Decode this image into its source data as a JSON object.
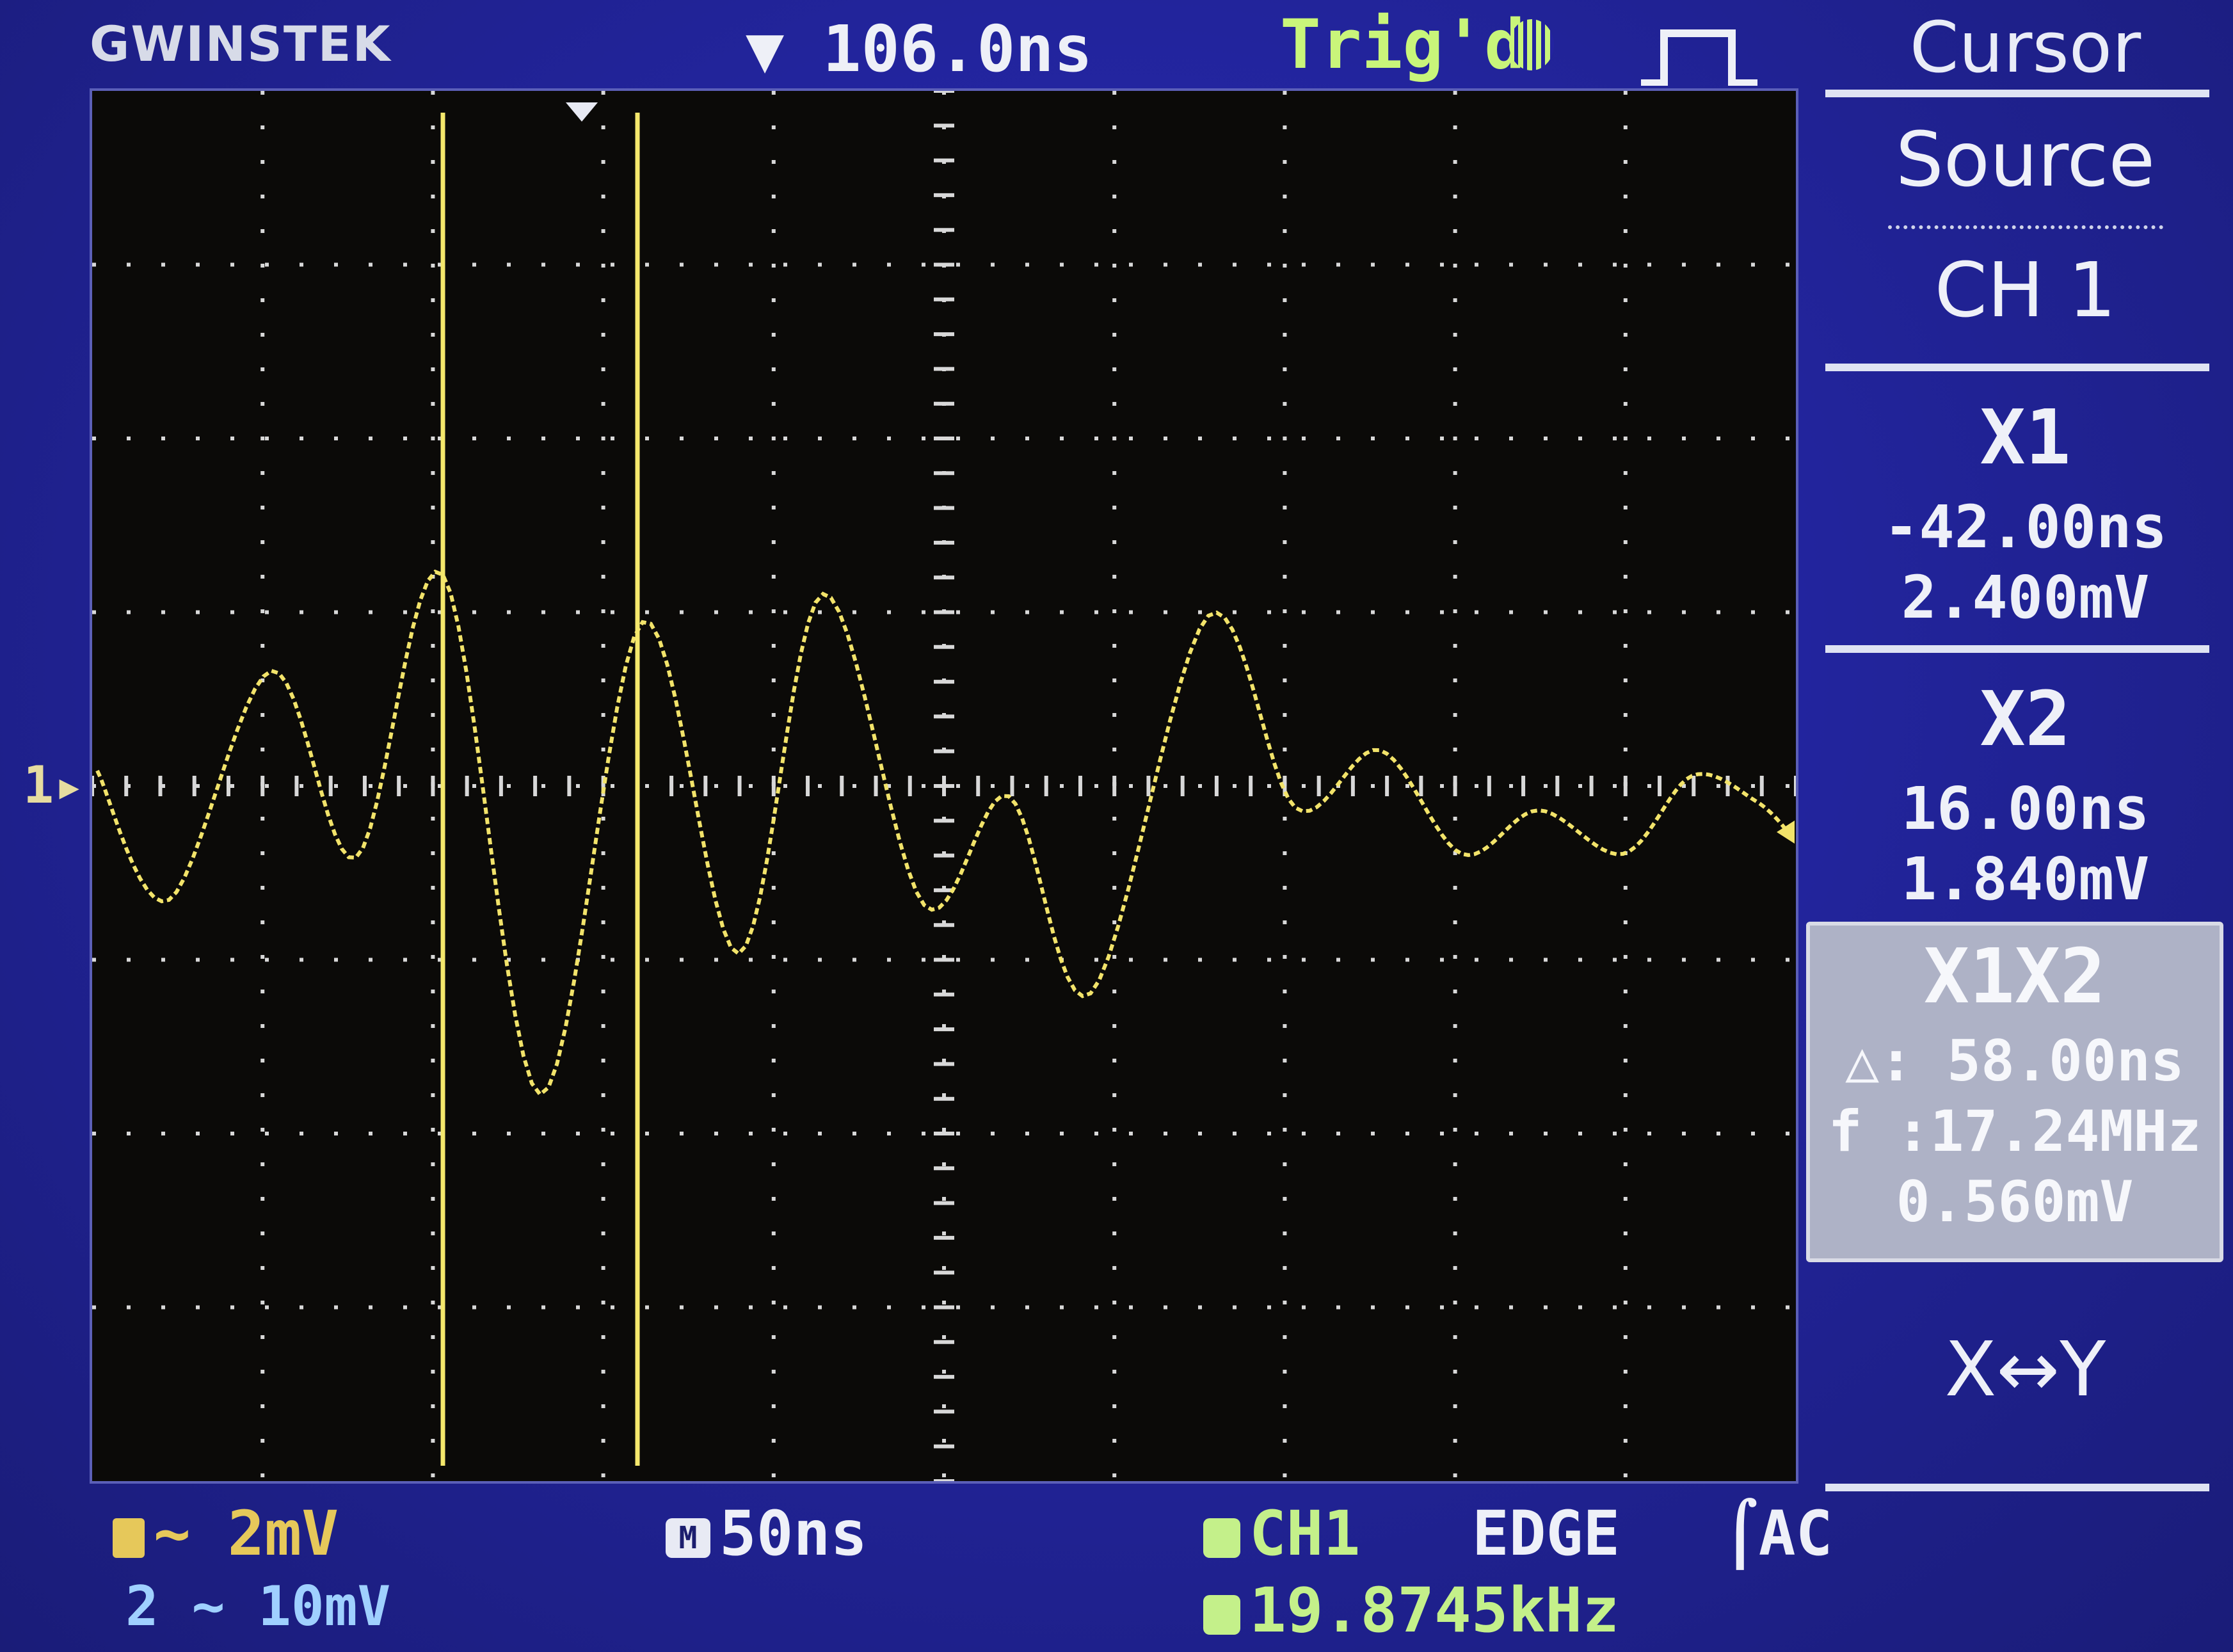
{
  "header": {
    "brand": "GWINSTEK",
    "trigger_position": "▼ 106.0ns",
    "trigger_status": "Trig'd"
  },
  "side_menu": {
    "title": "Cursor",
    "source_label": "Source",
    "source_value": "CH 1",
    "x1_label": "X1",
    "x1_time": "-42.00ns",
    "x1_voltage": "2.400mV",
    "x2_label": "X2",
    "x2_time": "16.00ns",
    "x2_voltage": "1.840mV",
    "x1x2_label": "X1X2",
    "delta_time": "△: 58.00ns",
    "frequency": "f :17.24MHz",
    "delta_voltage": "0.560mV",
    "swap_label": "X↔Y"
  },
  "channel_marker": "1",
  "status_bar": {
    "ch1_scale": "~ 2mV",
    "ch2_label": "2",
    "ch2_scale": "~ 10mV",
    "timebase": "50ns",
    "trigger_source": "CH1",
    "trigger_type": "EDGE",
    "trigger_coupling": "AC",
    "frequency_readout": "19.8745kHz"
  },
  "colors": {
    "trace": "#f2e36a",
    "cursor": "#f5e86c",
    "screen_bg": "#2325a0",
    "grid_bg": "#0b0a08",
    "trig_green": "#c9f57a"
  }
}
